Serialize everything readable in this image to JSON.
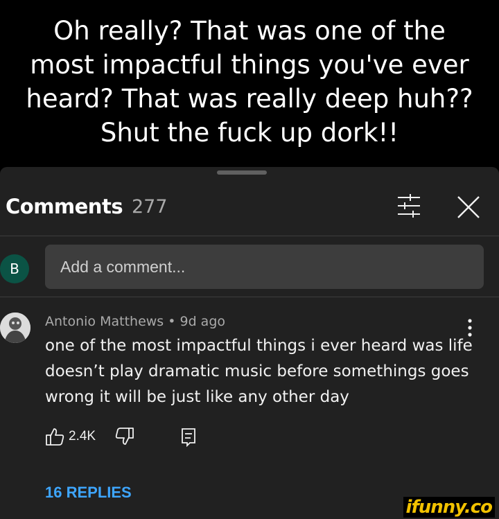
{
  "caption": "Oh really? That was one of the\nmost impactful things you've ever\nheard? That was really deep huh??\nShut the fuck up dork!!",
  "comments_panel": {
    "title": "Comments",
    "count": "277"
  },
  "composer": {
    "avatar_letter": "B",
    "placeholder": "Add a comment..."
  },
  "comment": {
    "meta": "Antonio Matthews • 9d ago",
    "text": "one of the most impactful things i ever heard was life doesn’t play dramatic music before somethings goes wrong it will be just like any other day",
    "like_count": "2.4K",
    "replies_label": "16 REPLIES"
  },
  "watermark": "ifunny.co",
  "colors": {
    "panel_bg": "#212121",
    "link_blue": "#3ea6ff",
    "avatar_green": "#0b5345",
    "watermark_yellow": "#f2c200"
  },
  "icons": [
    "filter-icon",
    "close-icon",
    "more-vert-icon",
    "thumb-up-icon",
    "thumb-down-icon",
    "reply-icon"
  ]
}
